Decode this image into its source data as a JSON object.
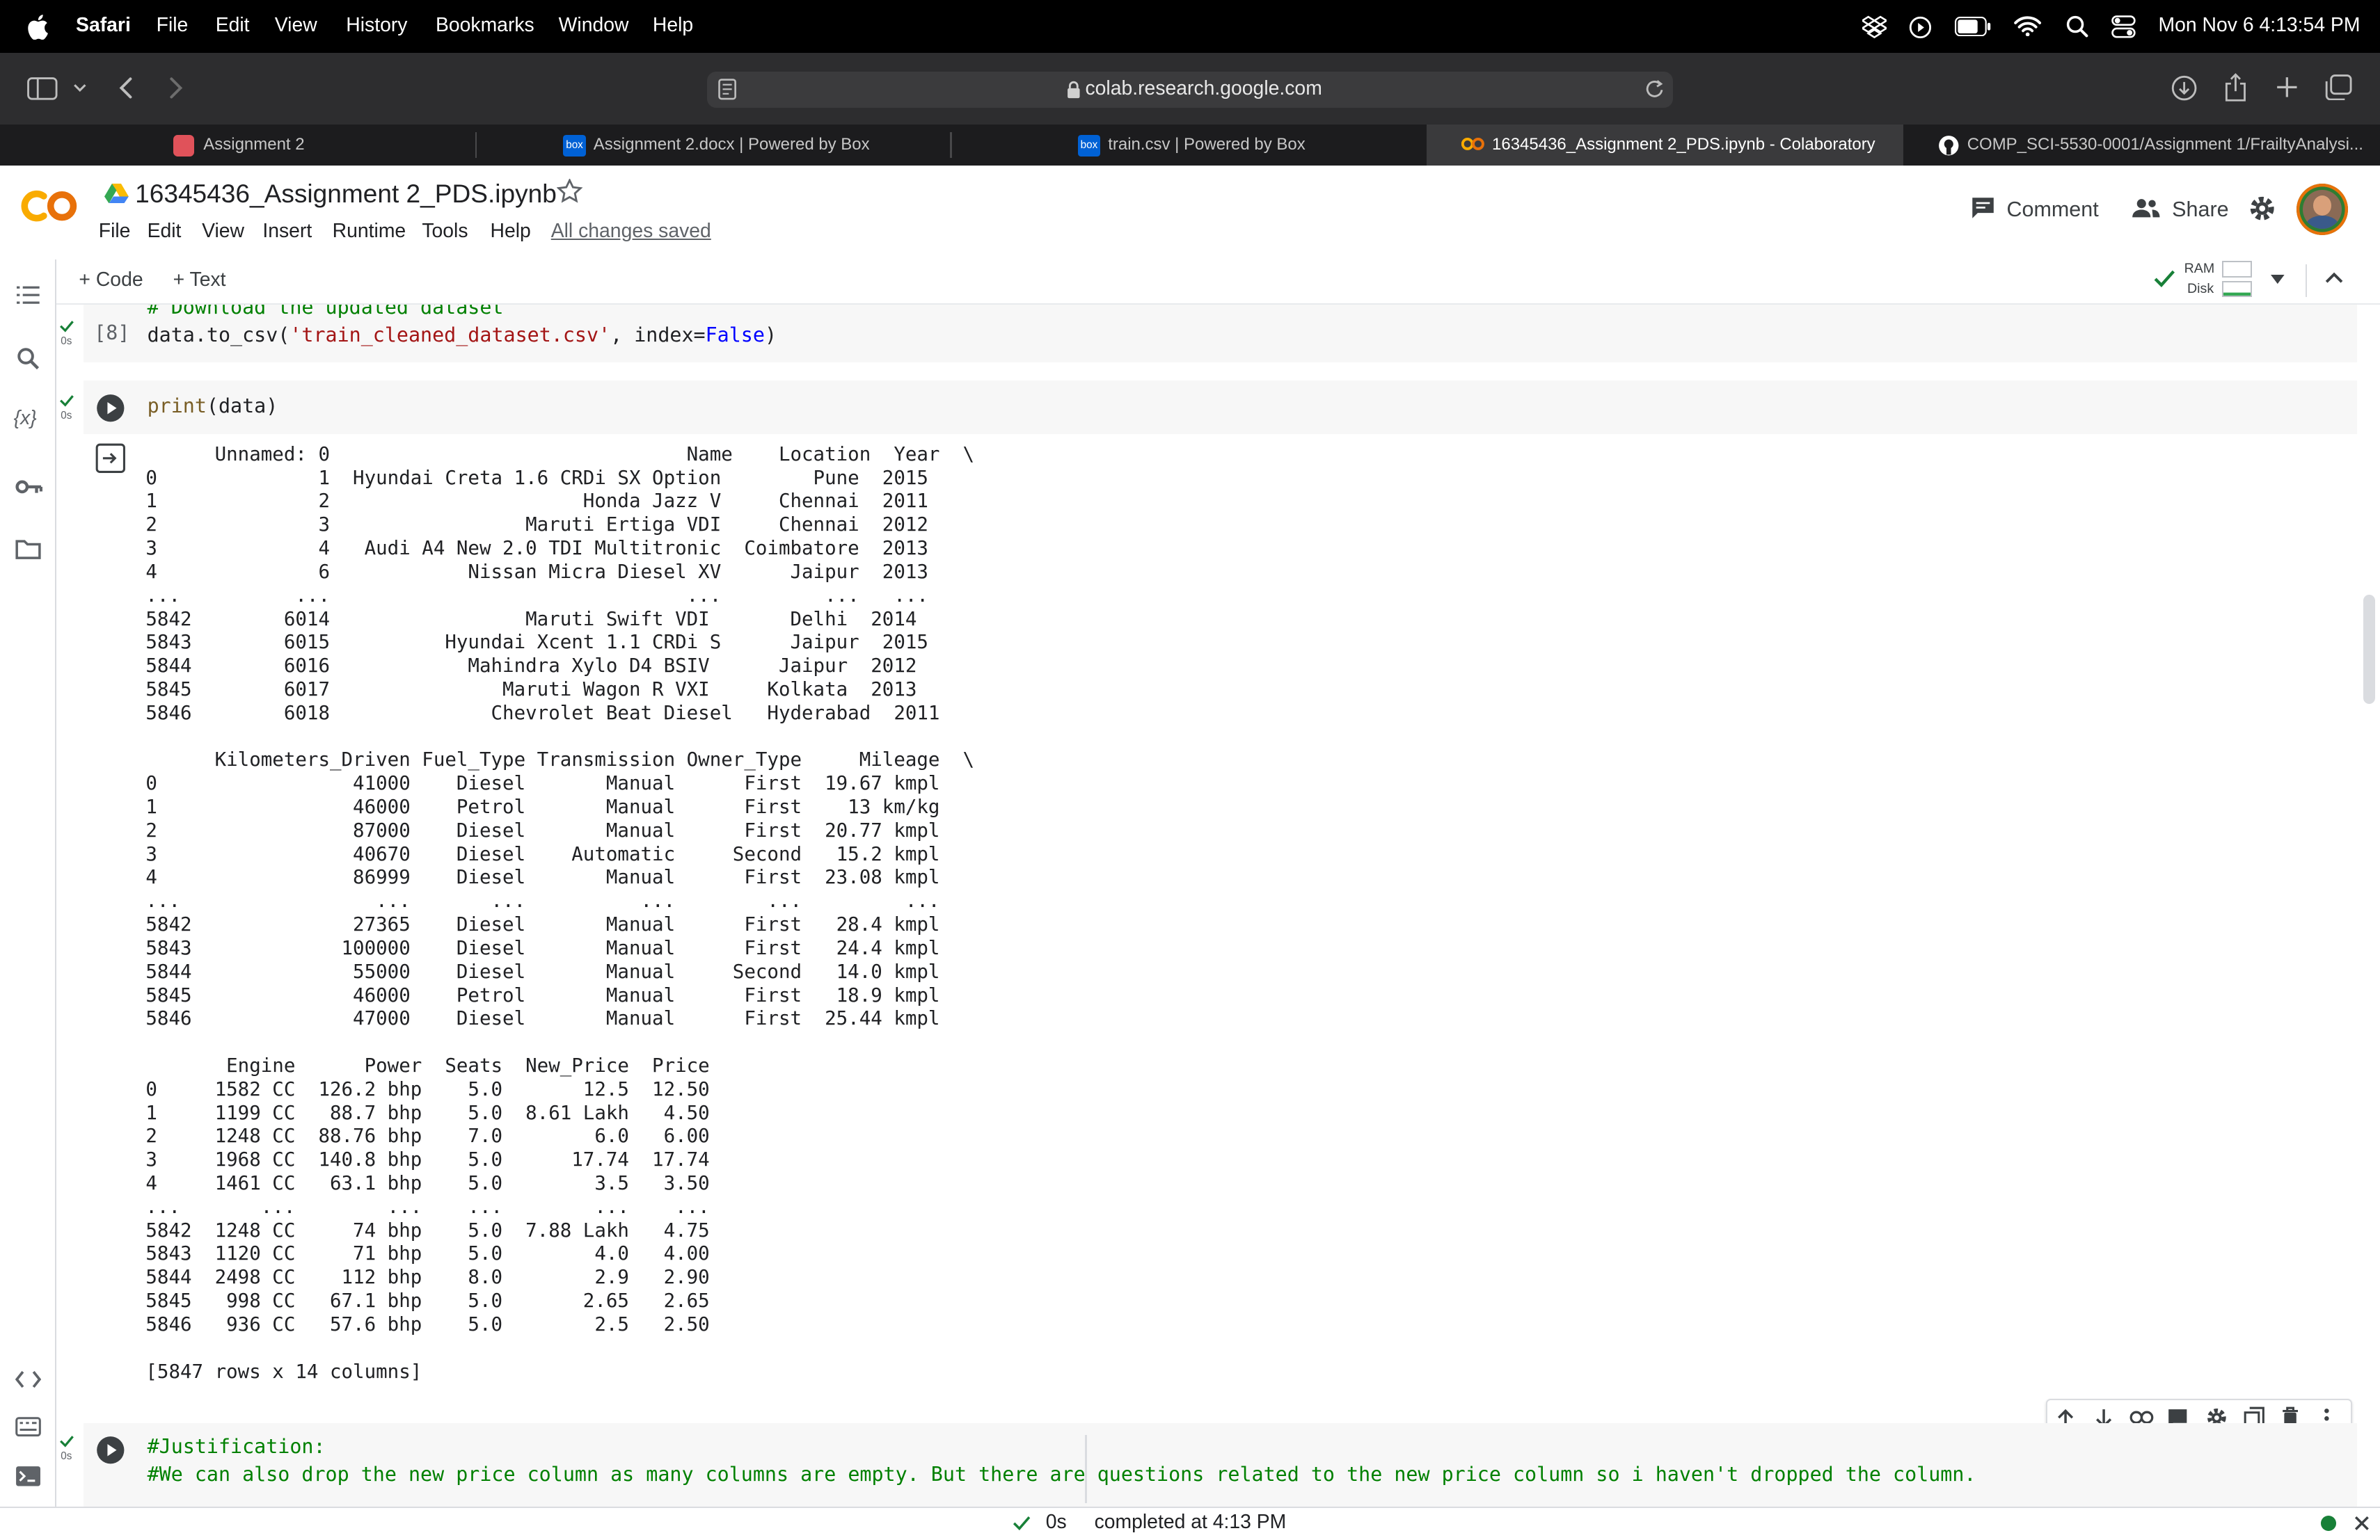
{
  "menubar": {
    "app": "Safari",
    "items": [
      "File",
      "Edit",
      "View",
      "History",
      "Bookmarks",
      "Window",
      "Help"
    ],
    "clock": "Mon Nov 6  4:13:54 PM"
  },
  "browser": {
    "url": "colab.research.google.com",
    "tabs": [
      {
        "label": "Assignment 2"
      },
      {
        "label": "Assignment 2.docx | Powered by Box"
      },
      {
        "label": "train.csv | Powered by Box"
      },
      {
        "label": "16345436_Assignment 2_PDS.ipynb - Colaboratory"
      },
      {
        "label": "COMP_SCI-5530-0001/Assignment 1/FrailtyAnalysi..."
      }
    ]
  },
  "colab": {
    "logo": "CO",
    "notebook_title": "16345436_Assignment 2_PDS.ipynb",
    "menu": [
      "File",
      "Edit",
      "View",
      "Insert",
      "Runtime",
      "Tools",
      "Help"
    ],
    "saved_status": "All changes saved",
    "comment_label": "Comment",
    "share_label": "Share",
    "add_code_label": "+ Code",
    "add_text_label": "+ Text",
    "ram_label": "RAM",
    "disk_label": "Disk"
  },
  "cells": {
    "c1": {
      "exec": "[8]",
      "time": "0s",
      "comment_line": "# Download the updated dataset",
      "line_pre": "data.to_csv(",
      "line_str": "'train_cleaned_dataset.csv'",
      "line_mid": ", index=",
      "line_kw": "False",
      "line_post": ")"
    },
    "c2": {
      "time": "0s",
      "code": "print(data)",
      "output": "      Unnamed: 0                               Name    Location  Year  \\\n0              1  Hyundai Creta 1.6 CRDi SX Option        Pune  2015   \n1              2                      Honda Jazz V     Chennai  2011   \n2              3                 Maruti Ertiga VDI     Chennai  2012   \n3              4   Audi A4 New 2.0 TDI Multitronic  Coimbatore  2013   \n4              6            Nissan Micra Diesel XV      Jaipur  2013   \n...          ...                               ...         ...   ...   \n5842        6014                 Maruti Swift VDI       Delhi  2014   \n5843        6015          Hyundai Xcent 1.1 CRDi S      Jaipur  2015   \n5844        6016            Mahindra Xylo D4 BSIV      Jaipur  2012   \n5845        6017               Maruti Wagon R VXI     Kolkata  2013   \n5846        6018              Chevrolet Beat Diesel   Hyderabad  2011   \n\n      Kilometers_Driven Fuel_Type Transmission Owner_Type     Mileage  \\\n0                 41000    Diesel       Manual      First  19.67 kmpl   \n1                 46000    Petrol       Manual      First    13 km/kg   \n2                 87000    Diesel       Manual      First  20.77 kmpl   \n3                 40670    Diesel    Automatic     Second   15.2 kmpl   \n4                 86999    Diesel       Manual      First  23.08 kmpl   \n...                 ...       ...          ...        ...         ...   \n5842              27365    Diesel       Manual      First   28.4 kmpl   \n5843             100000    Diesel       Manual      First   24.4 kmpl   \n5844              55000    Diesel       Manual     Second   14.0 kmpl   \n5845              46000    Petrol       Manual      First   18.9 kmpl   \n5846              47000    Diesel       Manual      First  25.44 kmpl   \n\n       Engine      Power  Seats  New_Price  Price  \n0     1582 CC  126.2 bhp    5.0       12.5  12.50  \n1     1199 CC   88.7 bhp    5.0  8.61 Lakh   4.50  \n2     1248 CC  88.76 bhp    7.0        6.0   6.00  \n3     1968 CC  140.8 bhp    5.0      17.74  17.74  \n4     1461 CC   63.1 bhp    5.0        3.5   3.50  \n...       ...        ...    ...        ...    ...  \n5842  1248 CC     74 bhp    5.0  7.88 Lakh   4.75  \n5843  1120 CC     71 bhp    5.0        4.0   4.00  \n5844  2498 CC    112 bhp    8.0        2.9   2.90  \n5845   998 CC   67.1 bhp    5.0       2.65   2.65  \n5846   936 CC   57.6 bhp    5.0        2.5   2.50  \n\n[5847 rows x 14 columns]"
    },
    "c3": {
      "time": "0s",
      "line1": "#Justification:",
      "line2": "#We can also drop the new price column as many columns are empty. But there are questions related to the new price column so i haven't dropped the column."
    }
  },
  "status": {
    "elapsed": "0s",
    "completed": "completed at 4:13 PM"
  }
}
